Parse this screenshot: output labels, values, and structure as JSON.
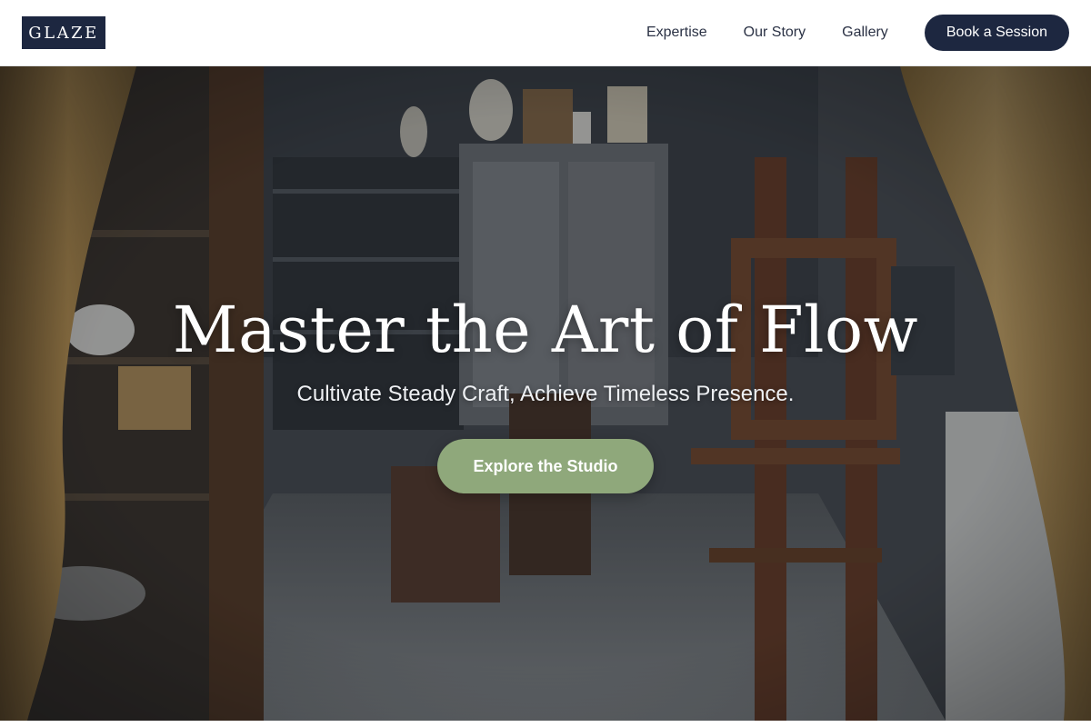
{
  "header": {
    "logo_text": "GLAZE",
    "nav": [
      {
        "label": "Expertise"
      },
      {
        "label": "Our Story"
      },
      {
        "label": "Gallery"
      }
    ],
    "cta_label": "Book a Session"
  },
  "hero": {
    "title": "Master the Art of Flow",
    "subtitle": "Cultivate Steady Craft, Achieve Timeless Presence.",
    "cta_label": "Explore the Studio",
    "background": "pottery-studio-photo"
  },
  "colors": {
    "brand_navy": "#1d2740",
    "accent_sage": "#8fa87b",
    "nav_text": "#2b3245"
  }
}
